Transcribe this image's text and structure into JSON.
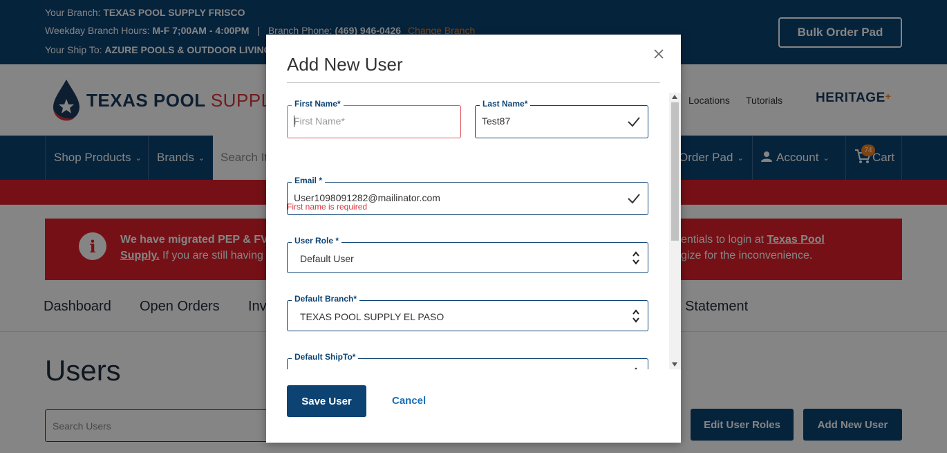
{
  "topbar": {
    "branch_label": "Your Branch:",
    "branch_value": "TEXAS POOL SUPPLY FRISCO",
    "hours_label": "Weekday Branch Hours:",
    "hours_value": "M-F 7;00AM - 4:00PM",
    "separator": "|",
    "phone_label": "Branch Phone:",
    "phone_value": "(469) 946-0426",
    "change_branch": "Change Branch",
    "shipto_label": "Your Ship To:",
    "shipto_value": "AZURE POOLS & OUTDOOR LIVING",
    "bulk_order_pad": "Bulk Order Pad"
  },
  "header": {
    "logo_word1": "TEXAS POOL",
    "logo_word2": "SUPPLY",
    "locations": "Locations",
    "tutorials": "Tutorials",
    "heritage": "HERITAGE",
    "heritage_plus": "+"
  },
  "nav": {
    "shop_products": "Shop Products",
    "brands": "Brands",
    "search_placeholder": "Search It",
    "order_pad": "Order Pad",
    "account": "Account",
    "cart": "Cart",
    "cart_count": "74"
  },
  "alert": {
    "line1_bold": "We have migrated PEP & FV",
    "line1_right": "entials to login at ",
    "link_part1": "Texas Pool",
    "link_part2": "Supply.",
    "line2_text": " If you are still having",
    "line2_right": "gize for the inconvenience."
  },
  "tabs": [
    "Dashboard",
    "Open Orders",
    "Inv",
    "Statement"
  ],
  "page": {
    "title": "Users",
    "search_placeholder": "Search Users",
    "edit_roles": "Edit User Roles",
    "add_new_user": "Add New User"
  },
  "modal": {
    "title": "Add New User",
    "first_name_label": "First Name*",
    "first_name_placeholder": "First Name*",
    "first_name_error": "First name is required",
    "last_name_label": "Last Name*",
    "last_name_value": "Test87",
    "email_label": "Email *",
    "email_value": "User1098091282@mailinator.com",
    "role_label": "User Role *",
    "role_value": "Default User",
    "branch_label": "Default Branch*",
    "branch_value": "TEXAS POOL SUPPLY EL PASO",
    "shipto_label": "Default ShipTo*",
    "save": "Save User",
    "cancel": "Cancel"
  },
  "colors": {
    "navy": "#0d4373",
    "red": "#e1222b",
    "orange": "#f58220",
    "error": "#d8343b",
    "link": "#1a6fb5"
  }
}
